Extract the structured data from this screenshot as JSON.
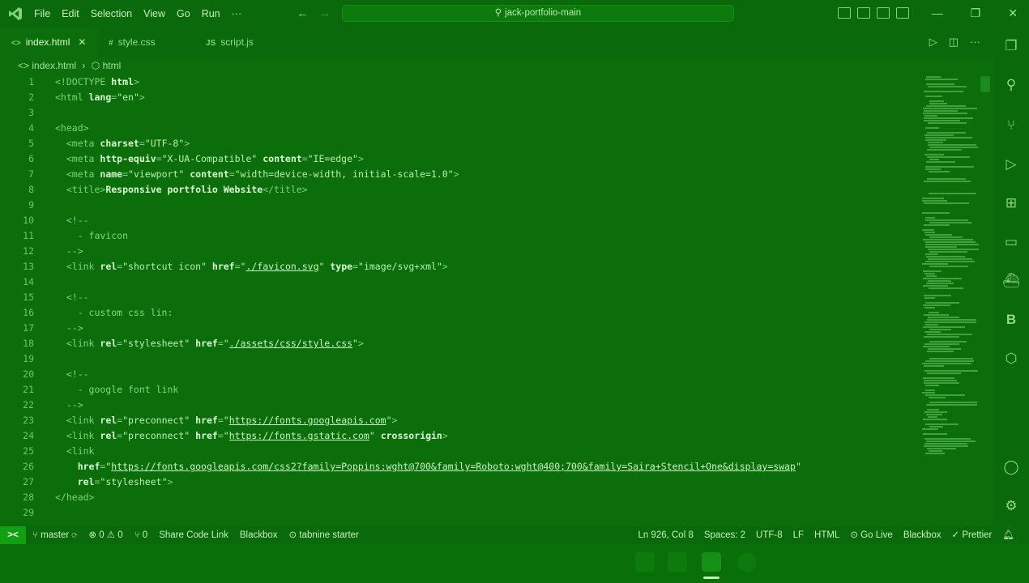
{
  "menu": [
    "File",
    "Edit",
    "Selection",
    "View",
    "Go",
    "Run",
    "···"
  ],
  "search": {
    "text": "jack-portfolio-main"
  },
  "tabs": [
    {
      "icon": "<>",
      "label": "index.html",
      "close": "✕"
    },
    {
      "icon": "#",
      "label": "style.css"
    },
    {
      "icon": "JS",
      "label": "script.js"
    }
  ],
  "breadcrumb": {
    "file": "index.html",
    "symbol": "html"
  },
  "code_lines": [
    {
      "n": "1",
      "segs": [
        [
          "tag",
          "<!DOCTYPE "
        ],
        [
          "kw",
          "html"
        ],
        [
          "tag",
          ">"
        ]
      ]
    },
    {
      "n": "2",
      "segs": [
        [
          "tag",
          "<html "
        ],
        [
          "kw",
          "lang"
        ],
        [
          "tag",
          "="
        ],
        [
          "str",
          "\"en\""
        ],
        [
          "tag",
          ">"
        ]
      ]
    },
    {
      "n": "3",
      "segs": []
    },
    {
      "n": "4",
      "segs": [
        [
          "tag",
          "<head>"
        ]
      ]
    },
    {
      "n": "5",
      "segs": [
        [
          "tag",
          "  <meta "
        ],
        [
          "kw",
          "charset"
        ],
        [
          "tag",
          "="
        ],
        [
          "str",
          "\"UTF-8\""
        ],
        [
          "tag",
          ">"
        ]
      ]
    },
    {
      "n": "6",
      "segs": [
        [
          "tag",
          "  <meta "
        ],
        [
          "kw",
          "http-equiv"
        ],
        [
          "tag",
          "="
        ],
        [
          "str",
          "\"X-UA-Compatible\""
        ],
        [
          "tag",
          " "
        ],
        [
          "kw",
          "content"
        ],
        [
          "tag",
          "="
        ],
        [
          "str",
          "\"IE=edge\""
        ],
        [
          "tag",
          ">"
        ]
      ]
    },
    {
      "n": "7",
      "segs": [
        [
          "tag",
          "  <meta "
        ],
        [
          "kw",
          "name"
        ],
        [
          "tag",
          "="
        ],
        [
          "str",
          "\"viewport\""
        ],
        [
          "tag",
          " "
        ],
        [
          "kw",
          "content"
        ],
        [
          "tag",
          "="
        ],
        [
          "str",
          "\"width=device-width, initial-scale=1.0\""
        ],
        [
          "tag",
          ">"
        ]
      ]
    },
    {
      "n": "8",
      "segs": [
        [
          "tag",
          "  <title>"
        ],
        [
          "txt",
          "Responsive portfolio Website"
        ],
        [
          "tag",
          "</title>"
        ]
      ]
    },
    {
      "n": "9",
      "segs": []
    },
    {
      "n": "10",
      "segs": [
        [
          "cmt",
          "  <!--"
        ]
      ]
    },
    {
      "n": "11",
      "segs": [
        [
          "cmt",
          "    - favicon"
        ]
      ]
    },
    {
      "n": "12",
      "segs": [
        [
          "cmt",
          "  -->"
        ]
      ]
    },
    {
      "n": "13",
      "segs": [
        [
          "tag",
          "  <link "
        ],
        [
          "kw",
          "rel"
        ],
        [
          "tag",
          "="
        ],
        [
          "str",
          "\"shortcut icon\""
        ],
        [
          "tag",
          " "
        ],
        [
          "kw",
          "href"
        ],
        [
          "tag",
          "="
        ],
        [
          "str",
          "\""
        ],
        [
          "url",
          "./favicon.svg"
        ],
        [
          "str",
          "\""
        ],
        [
          "tag",
          " "
        ],
        [
          "kw",
          "type"
        ],
        [
          "tag",
          "="
        ],
        [
          "str",
          "\"image/svg+xml\""
        ],
        [
          "tag",
          ">"
        ]
      ]
    },
    {
      "n": "14",
      "segs": []
    },
    {
      "n": "15",
      "segs": [
        [
          "cmt",
          "  <!--"
        ]
      ]
    },
    {
      "n": "16",
      "segs": [
        [
          "cmt",
          "    - custom css lin:"
        ]
      ]
    },
    {
      "n": "17",
      "segs": [
        [
          "cmt",
          "  -->"
        ]
      ]
    },
    {
      "n": "18",
      "segs": [
        [
          "tag",
          "  <link "
        ],
        [
          "kw",
          "rel"
        ],
        [
          "tag",
          "="
        ],
        [
          "str",
          "\"stylesheet\""
        ],
        [
          "tag",
          " "
        ],
        [
          "kw",
          "href"
        ],
        [
          "tag",
          "="
        ],
        [
          "str",
          "\""
        ],
        [
          "url",
          "./assets/css/style.css"
        ],
        [
          "str",
          "\""
        ],
        [
          "tag",
          ">"
        ]
      ]
    },
    {
      "n": "19",
      "segs": []
    },
    {
      "n": "20",
      "segs": [
        [
          "cmt",
          "  <!--"
        ]
      ]
    },
    {
      "n": "21",
      "segs": [
        [
          "cmt",
          "    - google font link"
        ]
      ]
    },
    {
      "n": "22",
      "segs": [
        [
          "cmt",
          "  -->"
        ]
      ]
    },
    {
      "n": "23",
      "segs": [
        [
          "tag",
          "  <link "
        ],
        [
          "kw",
          "rel"
        ],
        [
          "tag",
          "="
        ],
        [
          "str",
          "\"preconnect\""
        ],
        [
          "tag",
          " "
        ],
        [
          "kw",
          "href"
        ],
        [
          "tag",
          "="
        ],
        [
          "str",
          "\""
        ],
        [
          "url",
          "https://fonts.googleapis.com"
        ],
        [
          "str",
          "\""
        ],
        [
          "tag",
          ">"
        ]
      ]
    },
    {
      "n": "24",
      "segs": [
        [
          "tag",
          "  <link "
        ],
        [
          "kw",
          "rel"
        ],
        [
          "tag",
          "="
        ],
        [
          "str",
          "\"preconnect\""
        ],
        [
          "tag",
          " "
        ],
        [
          "kw",
          "href"
        ],
        [
          "tag",
          "="
        ],
        [
          "str",
          "\""
        ],
        [
          "url",
          "https://fonts.gstatic.com"
        ],
        [
          "str",
          "\""
        ],
        [
          "tag",
          " "
        ],
        [
          "kw",
          "crossorigin"
        ],
        [
          "tag",
          ">"
        ]
      ]
    },
    {
      "n": "25",
      "segs": [
        [
          "tag",
          "  <link"
        ]
      ]
    },
    {
      "n": "26",
      "segs": [
        [
          "kw",
          "    href"
        ],
        [
          "tag",
          "="
        ],
        [
          "str",
          "\""
        ],
        [
          "url",
          "https://fonts.googleapis.com/css2?family=Poppins:wght@700&family=Roboto:wght@400;700&family=Saira+Stencil+One&display=swap"
        ],
        [
          "str",
          "\""
        ]
      ]
    },
    {
      "n": "27",
      "segs": [
        [
          "kw",
          "    rel"
        ],
        [
          "tag",
          "="
        ],
        [
          "str",
          "\"stylesheet\""
        ],
        [
          "tag",
          ">"
        ]
      ]
    },
    {
      "n": "28",
      "segs": [
        [
          "tag",
          "</head>"
        ]
      ]
    },
    {
      "n": "29",
      "segs": []
    }
  ],
  "status_left": [
    "master",
    "⊗ 0 ⚠ 0",
    "⑂ 0",
    "Share Code Link",
    "Blackbox",
    "⊙ tabnine starter"
  ],
  "status_right": [
    "Ln 926, Col 8",
    "Spaces: 2",
    "UTF-8",
    "LF",
    "HTML",
    "⊙ Go Live",
    "Blackbox",
    "✓ Prettier"
  ],
  "remote_label": "><",
  "colors": {
    "background": "#0b6e0b",
    "chrome": "#0a690a",
    "accent": "#12a012"
  },
  "activity_icons": [
    "explorer-icon",
    "search-icon",
    "source-control-icon",
    "run-debug-icon",
    "extensions-icon",
    "remote-explorer-icon",
    "docker-icon",
    "blackbox-icon",
    "live-share-icon",
    "account-icon",
    "settings-icon"
  ]
}
